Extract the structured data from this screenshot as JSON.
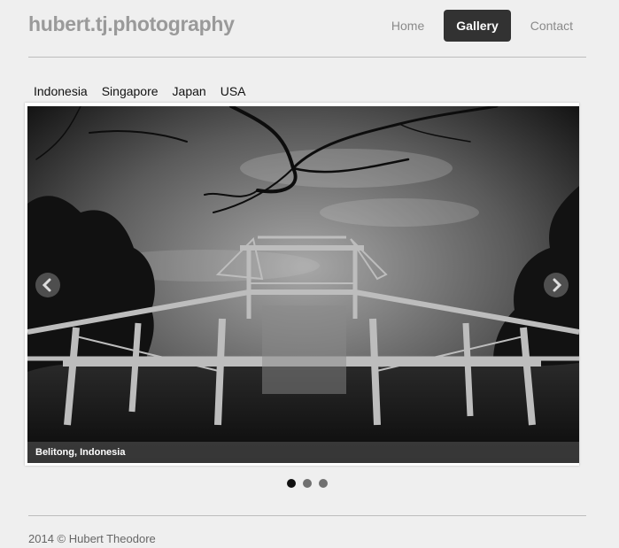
{
  "brand": "hubert.tj.photography",
  "nav": [
    {
      "label": "Home",
      "active": false
    },
    {
      "label": "Gallery",
      "active": true
    },
    {
      "label": "Contact",
      "active": false
    }
  ],
  "tabs": [
    "Indonesia",
    "Singapore",
    "Japan",
    "USA"
  ],
  "carousel": {
    "caption": "Belitong, Indonesia",
    "prev_icon": "chevron-left-icon",
    "next_icon": "chevron-right-icon",
    "slide_count": 3,
    "active_slide": 1
  },
  "footer": {
    "text": "2014 © Hubert Theodore"
  },
  "colors": {
    "accent": "#323232",
    "background": "#efefef",
    "brand": "#9a9a9a"
  }
}
